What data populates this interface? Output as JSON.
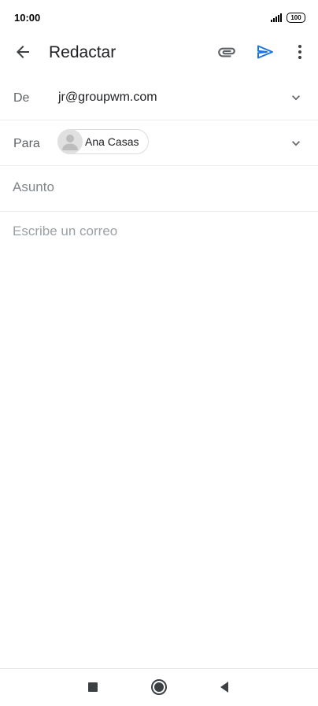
{
  "status_bar": {
    "time": "10:00",
    "battery": "100"
  },
  "app_bar": {
    "title": "Redactar",
    "icons": {
      "back": "arrow-left-icon",
      "attach": "paperclip-icon",
      "send": "send-icon",
      "more": "more-vertical-icon"
    }
  },
  "compose": {
    "from_label": "De",
    "from_value": "jr@groupwm.com",
    "to_label": "Para",
    "recipients": [
      {
        "name": "Ana Casas"
      }
    ],
    "subject_placeholder": "Asunto",
    "subject_value": "",
    "body_placeholder": "Escribe un correo",
    "body_value": ""
  },
  "colors": {
    "accent": "#1a73e8",
    "icon": "#5f6368",
    "text": "#202124",
    "placeholder": "#9aa0a6"
  },
  "nav_bar": {
    "icons": [
      "recents-square-icon",
      "home-circle-icon",
      "back-triangle-icon"
    ]
  }
}
